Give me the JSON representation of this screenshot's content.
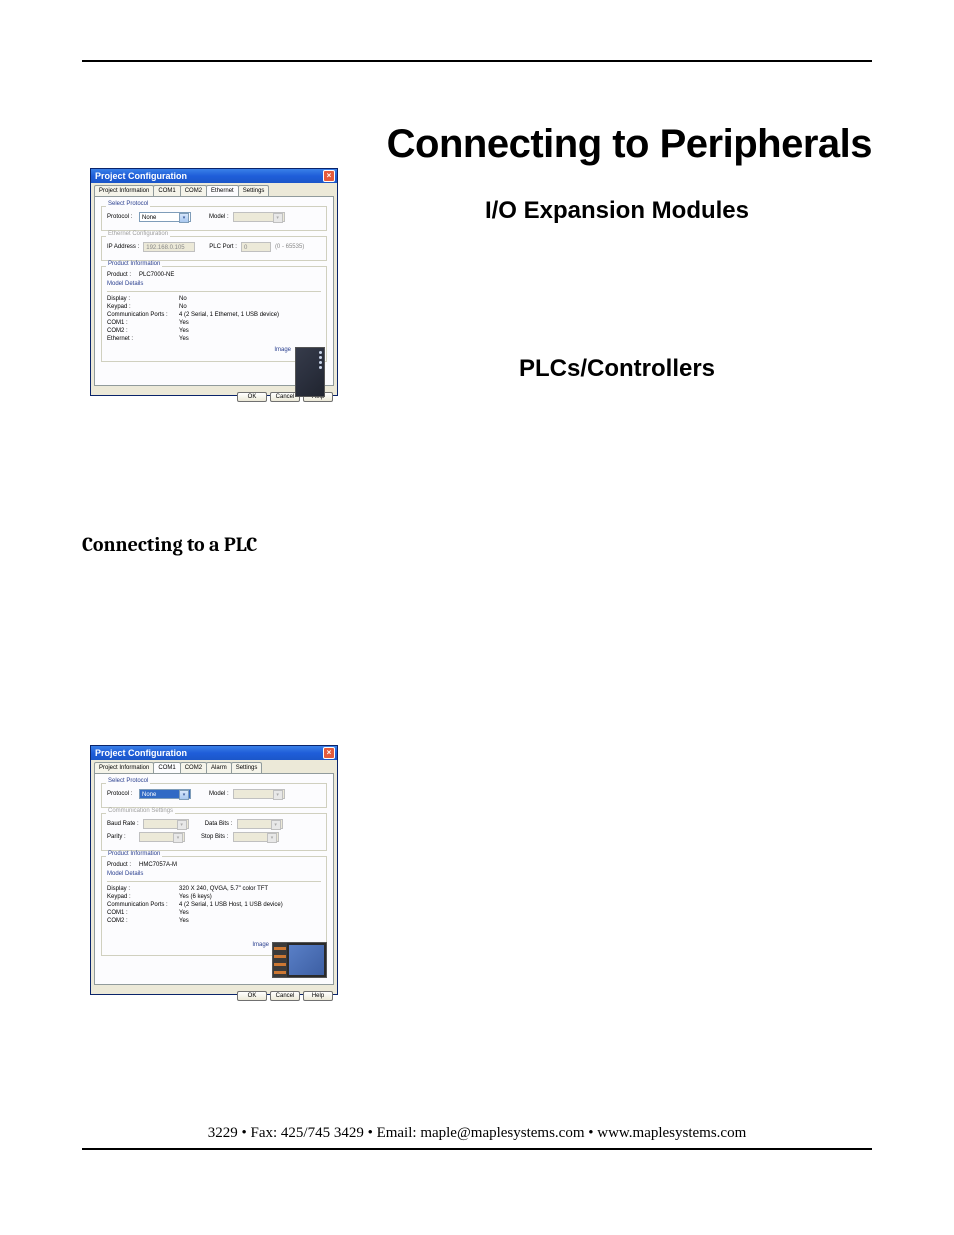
{
  "doc": {
    "title": "Connecting to Peripherals",
    "subtitle1": "I/O Expansion Modules",
    "subtitle2": "PLCs/Controllers",
    "section_heading": "Connecting to a PLC",
    "footer": "3229  • Fax: 425/745  3429 • Email: maple@maplesystems.com • www.maplesystems.com"
  },
  "dialog1": {
    "title": "Project Configuration",
    "close": "×",
    "tabs": [
      "Project Information",
      "COM1",
      "COM2",
      "Ethernet",
      "Settings"
    ],
    "active_tab": 3,
    "select_protocol": {
      "legend": "Select Protocol",
      "protocol_label": "Protocol :",
      "protocol_value": "None",
      "model_label": "Model :",
      "model_value": ""
    },
    "eth_config": {
      "legend": "Ethernet Configuration",
      "ip_label": "IP Address :",
      "ip_value": "192.168.0.105",
      "port_label": "PLC Port :",
      "port_value": "0",
      "port_range": "(0 - 65535)"
    },
    "product_info": {
      "legend": "Product Information",
      "product_label": "Product :",
      "product_value": "PLC7000-NE",
      "model_details_label": "Model Details",
      "image_label": "Image",
      "rows": [
        {
          "k": "Display :",
          "v": "No"
        },
        {
          "k": "Keypad :",
          "v": "No"
        },
        {
          "k": "Communication Ports :",
          "v": "4 (2 Serial, 1 Ethernet, 1 USB device)"
        },
        {
          "k": "COM1 :",
          "v": "Yes"
        },
        {
          "k": "COM2 :",
          "v": "Yes"
        },
        {
          "k": "Ethernet :",
          "v": "Yes"
        }
      ]
    },
    "buttons": {
      "ok": "OK",
      "cancel": "Cancel",
      "help": "Help"
    }
  },
  "dialog2": {
    "title": "Project Configuration",
    "close": "×",
    "tabs": [
      "Project Information",
      "COM1",
      "COM2",
      "Alarm",
      "Settings"
    ],
    "active_tab": 1,
    "select_protocol": {
      "legend": "Select Protocol",
      "protocol_label": "Protocol :",
      "protocol_value": "None",
      "model_label": "Model :",
      "model_value": ""
    },
    "comm_settings": {
      "legend": "Communication Settings",
      "baud_label": "Baud Rate :",
      "baud_value": "",
      "databits_label": "Data Bits :",
      "databits_value": "",
      "parity_label": "Parity :",
      "parity_value": "",
      "stopbits_label": "Stop Bits :",
      "stopbits_value": ""
    },
    "product_info": {
      "legend": "Product Information",
      "product_label": "Product :",
      "product_value": "HMC7057A-M",
      "model_details_label": "Model Details",
      "image_label": "Image",
      "rows": [
        {
          "k": "Display :",
          "v": "320 X 240, QVGA, 5.7\" color TFT"
        },
        {
          "k": "Keypad :",
          "v": "Yes (6 keys)"
        },
        {
          "k": "Communication Ports :",
          "v": "4 (2 Serial, 1 USB Host, 1 USB device)"
        },
        {
          "k": "COM1 :",
          "v": "Yes"
        },
        {
          "k": "COM2 :",
          "v": "Yes"
        }
      ]
    },
    "buttons": {
      "ok": "OK",
      "cancel": "Cancel",
      "help": "Help"
    }
  }
}
